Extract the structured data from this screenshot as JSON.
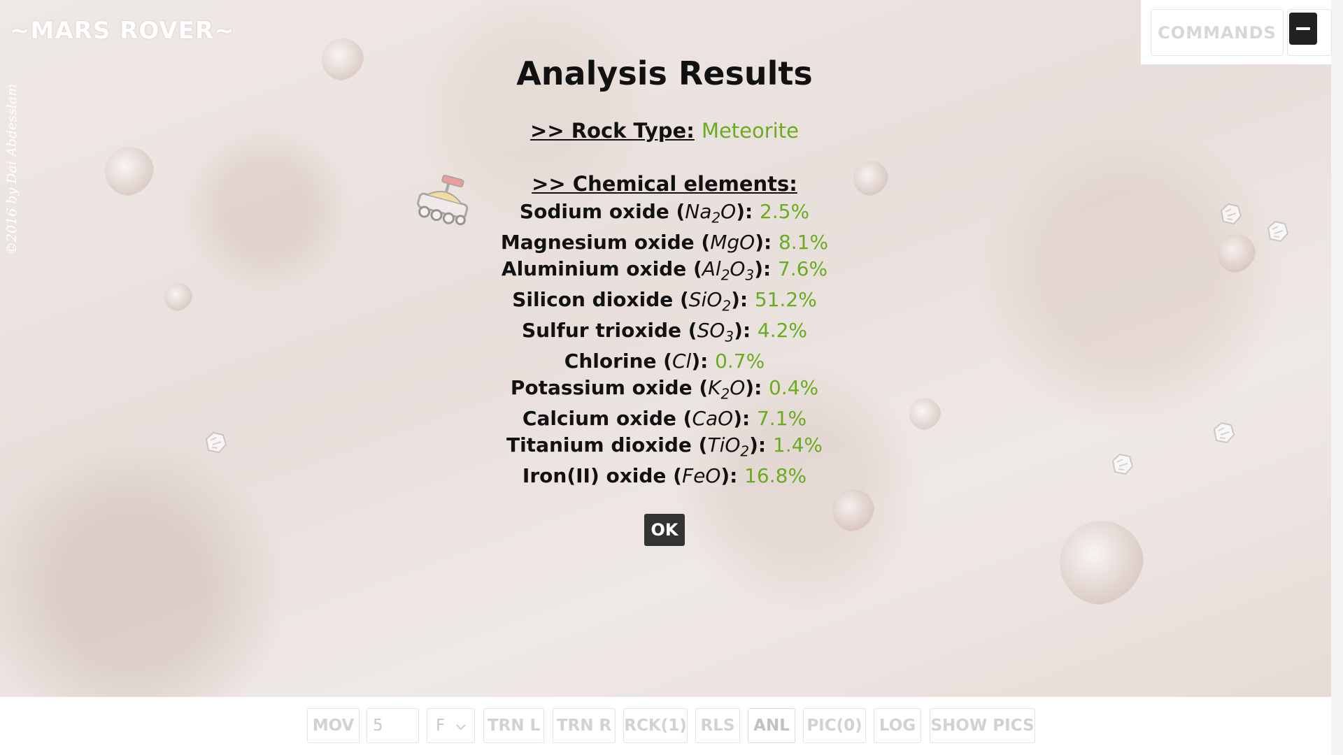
{
  "app": {
    "brand": "~MARS ROVER~",
    "credit": "©2016 by Dai Abdesslam"
  },
  "header": {
    "commands_label": "COMMANDS",
    "minimize_icon": "minus-icon"
  },
  "results": {
    "title": "Analysis Results",
    "rock_type_label": ">> Rock Type:",
    "rock_type_value": "Meteorite",
    "chemical_title": ">> Chemical elements:",
    "elements": [
      {
        "name": "Sodium oxide",
        "f": [
          "Na",
          "2",
          "O",
          ""
        ],
        "value": "2.5%"
      },
      {
        "name": "Magnesium oxide",
        "f": [
          "MgO",
          "",
          "",
          ""
        ],
        "value": "8.1%"
      },
      {
        "name": "Aluminium oxide",
        "f": [
          "Al",
          "2",
          "O",
          "3"
        ],
        "value": "7.6%"
      },
      {
        "name": "Silicon dioxide",
        "f": [
          "SiO",
          "2",
          "",
          ""
        ],
        "value": "51.2%"
      },
      {
        "name": "Sulfur trioxide",
        "f": [
          "SO",
          "3",
          "",
          ""
        ],
        "value": "4.2%"
      },
      {
        "name": "Chlorine",
        "f": [
          "Cl",
          "",
          "",
          ""
        ],
        "value": "0.7%"
      },
      {
        "name": "Potassium oxide",
        "f": [
          "K",
          "2",
          "O",
          ""
        ],
        "value": "0.4%"
      },
      {
        "name": "Calcium oxide",
        "f": [
          "CaO",
          "",
          "",
          ""
        ],
        "value": "7.1%"
      },
      {
        "name": "Titanium dioxide",
        "f": [
          "TiO",
          "2",
          "",
          ""
        ],
        "value": "1.4%"
      },
      {
        "name": "Iron(II) oxide",
        "f": [
          "FeO",
          "",
          "",
          ""
        ],
        "value": "16.8%"
      }
    ],
    "ok_label": "OK"
  },
  "toolbar": {
    "mov": "MOV",
    "steps_value": "5",
    "direction_value": "F",
    "trn_l": "TRN L",
    "trn_r": "TRN R",
    "rck": "RCK(1)",
    "rls": "RLS",
    "anl": "ANL",
    "pic": "PIC(0)",
    "log": "LOG",
    "show_pics": "SHOW PICS"
  },
  "colors": {
    "accent_green": "#6aab1f",
    "dark_button": "#333333"
  }
}
